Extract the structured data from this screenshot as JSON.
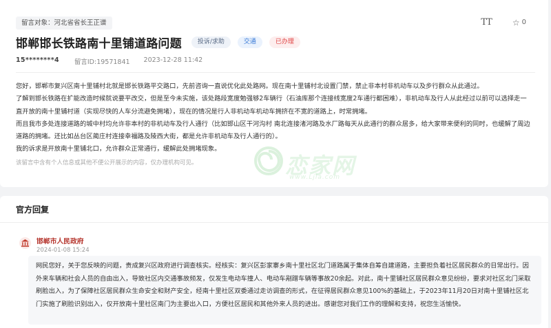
{
  "message": {
    "recipient_label": "留言对象：河北省省长王正谱",
    "title": "邯郸邯长铁路南十里铺道路问题",
    "tags": {
      "type": "投诉/求助",
      "field": "交通",
      "status": "已办理"
    },
    "user": "15********4",
    "message_id": "留言ID:19571841",
    "datetime": "2023-12-28 11:42",
    "font_size_tool": "TT",
    "favorite_count": "0",
    "paragraphs": [
      "您好，邯郸市复兴区南十里铺村北就是邯长铁路平交路口，先前咨询一直说优化此处路网。现在南十里铺村北设置门禁，禁止非本村非机动车以及步行群众从此通过。",
      "了解到邯长铁路在扩能改造时候就说要平改交，但是至今未实施，该处路段宽度勉强够2车辆行（石油库那个连接线宽度2车通行都困难），非机动车及行人从此经过以前可以选择走一直开放的南十里铺村道（实现尽快的人车分流避免拥堵），现在的情况是行人非机动车机动车拥挤在不宽的道路上，时常拥堵。",
      "而且我市多处连接道路的城中村均允许非本村的非机动车及行人通行（比如邯山区干河沟村 南北连接渚河路及水厂路每天从此通行的群众居多，给大家带来便利的同时，也缓解了周边道路的拥堵。还比如丛台区蔺庄村连接幸福路及陵西大街，都是允许非机动车及行人通行的）。",
      "我的诉求是开放南十里铺北口，允许群众正常通行，缓解此处拥堵现象。"
    ],
    "privacy_notice": "该留言中含有个人信息或其他不便公开展示的内容，仅办理机构可见。"
  },
  "watermark": {
    "text": "恋家网",
    "url": "www.Ljia.com"
  },
  "reply": {
    "section_title": "官方回复",
    "department": "邯郸市人民政府",
    "date": "2024-01-08 15:24",
    "text": "网民您好，关于您反映的问题，责成复兴区政府进行调查核实。经核实：复兴区彭家寨乡南十里社区北门道路属于集体自筹自建道路，主要担负着社区居民群众的日常出行。因外来车辆和社会人员的自由出入，导致社区内交通事故频发，仅发生电动车撞人、电动车剐蹭车辆等事故20余起。对此，南十里铺社区居民群众意见纷纷，要求对社区北门采取刷脸出入，为了保障社区居民群众生命安全和财产安全，经南十里社区双委通过走访调查的形式，在征得居民群众意见100%的基础上，于2023年11月20日对南十里铺社区北门实施了刷脸识别出入，仅开放南十里社区南门为主要出入口，方便社区居民和其他外来人员的进出。感谢您对我们工作的理解和支持，祝您生活愉快。"
  },
  "colors": {
    "status_red": "#e04545",
    "field_blue": "#3a7ad6",
    "department_red": "#b5352d",
    "watermark_green": "#5abe64"
  },
  "icons": {
    "font_size": "text-size-icon",
    "favorite": "star-outline-icon",
    "department": "government-building-icon",
    "watermark": "swirl-logo-icon"
  }
}
